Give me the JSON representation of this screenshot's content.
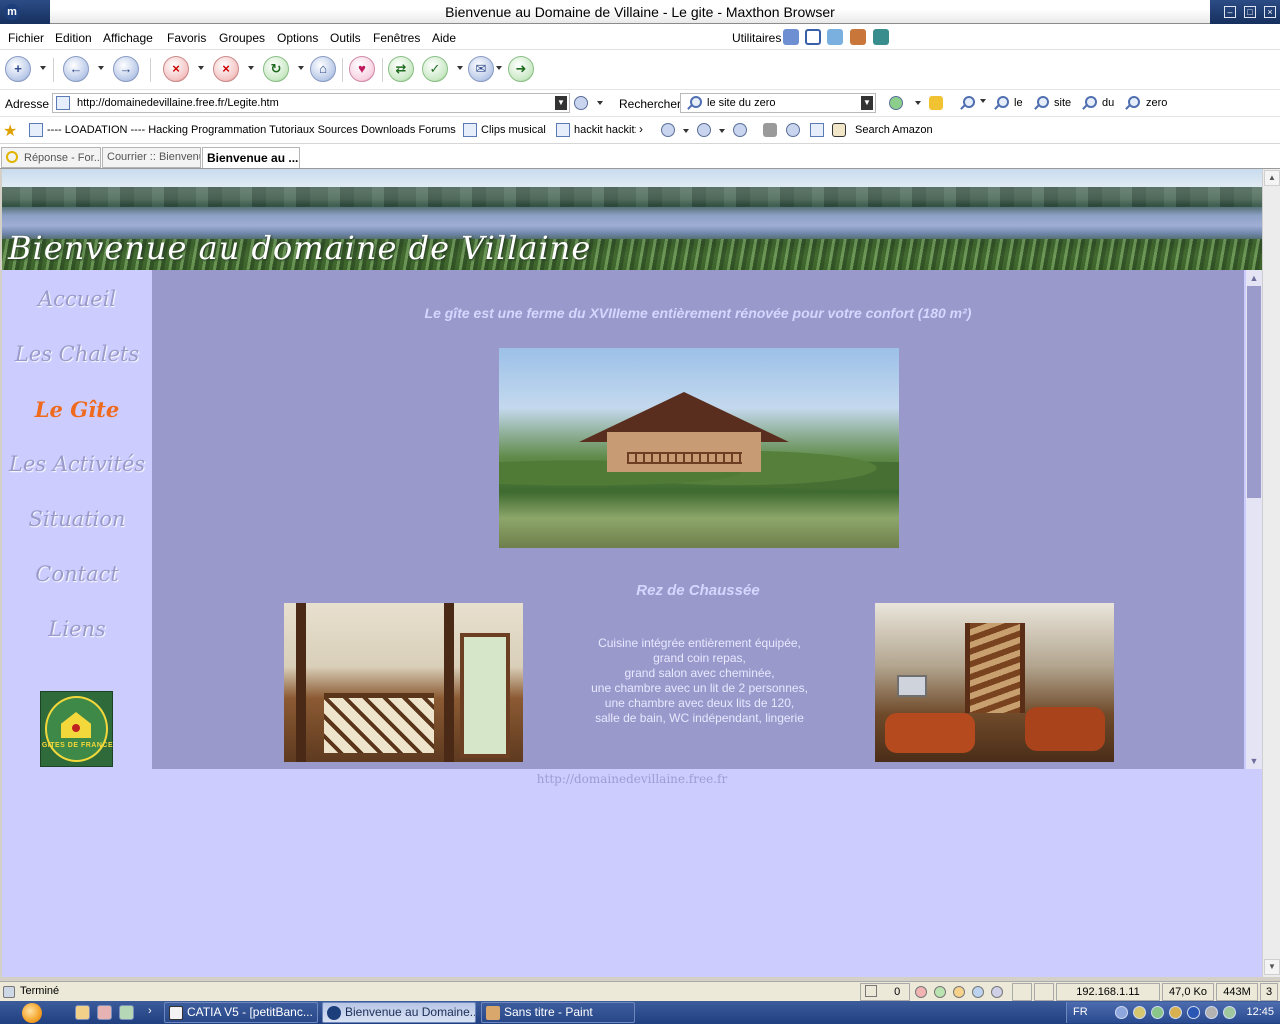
{
  "window": {
    "title": "Bienvenue au Domaine de Villaine - Le gite - Maxthon Browser",
    "app_icon": "m"
  },
  "menu": {
    "items": [
      "Fichier",
      "Edition",
      "Affichage",
      "Favoris",
      "Groupes",
      "Options",
      "Outils",
      "Fenêtres",
      "Aide"
    ],
    "utilities_label": "Utilitaires"
  },
  "address_bar": {
    "label": "Adresse",
    "url": "http://domainedevillaine.free.fr/Legite.htm",
    "search_label": "Rechercher",
    "search_value": "le site du zero",
    "keywords": [
      "le",
      "site",
      "du",
      "zero"
    ]
  },
  "links_bar": {
    "items": [
      "---- LOADATION ---- Hacking Programmation Tutoriaux Sources Downloads Forums",
      "Clips musical",
      "hackit hackit:",
      "Search Amazon"
    ]
  },
  "tabs": [
    {
      "label": "Réponse - For...",
      "active": false
    },
    {
      "label": "Courrier :: Bienvenu",
      "active": false
    },
    {
      "label": "Bienvenue au ...",
      "active": true
    }
  ],
  "page": {
    "banner_title": "Bienvenue au domaine de Villaine",
    "nav": [
      {
        "label": "Accueil",
        "current": false
      },
      {
        "label": "Les Chalets",
        "current": false
      },
      {
        "label": "Le Gîte",
        "current": true
      },
      {
        "label": "Les Activités",
        "current": false
      },
      {
        "label": "Situation",
        "current": false
      },
      {
        "label": "Contact",
        "current": false
      },
      {
        "label": "Liens",
        "current": false
      }
    ],
    "gites_logo_text": "GITES DE FRANCE",
    "headline": "Le gîte est une ferme du XVIIIeme entièrement rénovée pour votre confort (180 m²)",
    "section_title": "Rez de Chaussée",
    "description": [
      "Cuisine intégrée entièrement équipée,",
      "grand coin repas,",
      "grand salon avec cheminée,",
      "une chambre avec un lit de 2 personnes,",
      "une chambre avec deux lits de 120,",
      "salle de bain, WC indépendant, lingerie"
    ],
    "footer_url": "http://domainedevillaine.free.fr"
  },
  "status_bar": {
    "status": "Terminé",
    "count": "0",
    "ip": "192.168.1.11",
    "size": "47,0 Ko",
    "memory": "443M",
    "tabs_count": "3"
  },
  "taskbar": {
    "buttons": [
      {
        "label": "CATIA V5 - [petitBanc...",
        "active": false
      },
      {
        "label": "Bienvenue au Domaine...",
        "active": true
      },
      {
        "label": "Sans titre - Paint",
        "active": false
      }
    ],
    "language": "FR",
    "clock": "12:45"
  },
  "colors": {
    "page_background": "#ccccfe",
    "content_background": "#9999cc",
    "nav_current": "#f06a1d",
    "nav_default": "#9a9acb"
  }
}
